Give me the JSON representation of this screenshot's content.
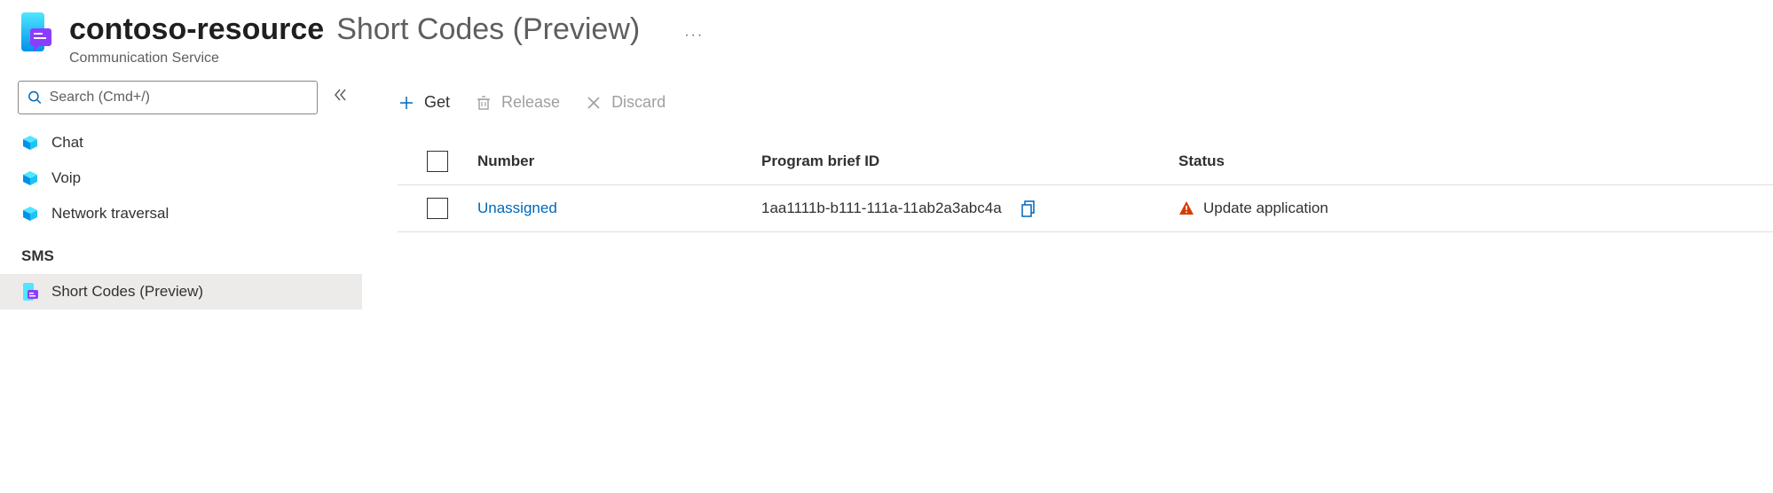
{
  "header": {
    "resource_name": "contoso-resource",
    "page_name": "Short Codes (Preview)",
    "subtitle": "Communication Service",
    "more": "···"
  },
  "search": {
    "placeholder": "Search (Cmd+/)"
  },
  "sidebar": {
    "items": [
      {
        "label": "Chat"
      },
      {
        "label": "Voip"
      },
      {
        "label": "Network traversal"
      }
    ],
    "group_sms_label": "SMS",
    "short_codes_label": "Short Codes (Preview)"
  },
  "toolbar": {
    "get_label": "Get",
    "release_label": "Release",
    "discard_label": "Discard"
  },
  "table": {
    "columns": {
      "number": "Number",
      "brief": "Program brief ID",
      "status": "Status"
    },
    "rows": [
      {
        "number": "Unassigned",
        "brief": "1aa1111b-b111-111a-11ab2a3abc4a",
        "status": "Update application"
      }
    ]
  }
}
